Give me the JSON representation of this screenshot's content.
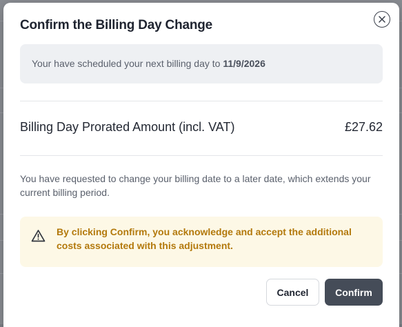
{
  "modal": {
    "title": "Confirm the Billing Day Change",
    "info": {
      "prefix": "Your have scheduled your next billing day to ",
      "date": "11/9/2026"
    },
    "amount": {
      "label": "Billing Day Prorated Amount (incl. VAT)",
      "value": "£27.62"
    },
    "description": "You have requested to change your billing date to a later date, which extends your current billing period.",
    "warning": {
      "icon": "warning-triangle-icon",
      "text": "By clicking Confirm, you acknowledge and accept the additional costs associated with this adjustment."
    },
    "buttons": {
      "cancel": "Cancel",
      "confirm": "Confirm"
    }
  },
  "colors": {
    "primary_button": "#454c58",
    "warning_text": "#b3790c",
    "warning_bg": "#fdf8e6",
    "info_bg": "#eef0f3"
  }
}
